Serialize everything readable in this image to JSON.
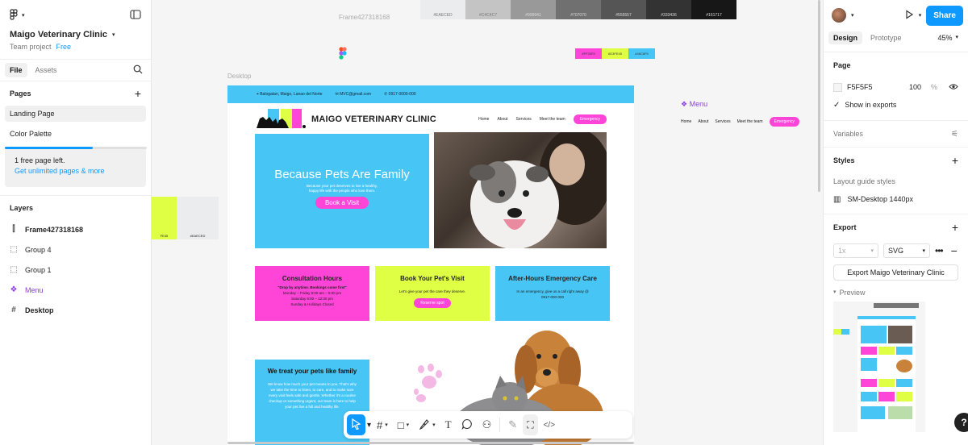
{
  "app": {
    "project_name": "Maigo Veterinary Clinic",
    "team": "Team project",
    "plan": "Free"
  },
  "left_panel": {
    "tabs": [
      "File",
      "Assets"
    ],
    "pages_title": "Pages",
    "pages": [
      "Landing Page",
      "Color Palette"
    ],
    "upsell": {
      "line1": "1 free page left.",
      "line2": "Get unlimited pages & more",
      "progress": 0.62
    },
    "layers_title": "Layers",
    "layers": [
      {
        "name": "Frame427318168",
        "icon": "frame-icon"
      },
      {
        "name": "Group 4",
        "icon": "group-icon"
      },
      {
        "name": "Group 1",
        "icon": "group-icon"
      },
      {
        "name": "Menu",
        "icon": "component-icon"
      },
      {
        "name": "Desktop",
        "icon": "frame-hash-icon"
      }
    ]
  },
  "right_panel": {
    "share": "Share",
    "tabs": [
      "Design",
      "Prototype"
    ],
    "zoom": "45%",
    "page_section": "Page",
    "page_color": "F5F5F5",
    "page_opacity": "100",
    "page_opacity_unit": "%",
    "show_in_exports": "Show in exports",
    "variables": "Variables",
    "styles": "Styles",
    "layout_guide_styles": "Layout guide styles",
    "style_item": "SM-Desktop 1440px",
    "export": "Export",
    "export_scale": "1x",
    "export_format": "SVG",
    "export_button": "Export Maigo Veterinary Clinic",
    "preview": "Preview",
    "help": "?"
  },
  "canvas": {
    "frame_label": "Frame427318168",
    "desktop_label": "Desktop",
    "palette": [
      {
        "hex": "#EAECED",
        "label": "#EAECED"
      },
      {
        "hex": "#C4C4C4",
        "label": "#C4C4C7"
      },
      {
        "hex": "#999999",
        "label": "#999941"
      },
      {
        "hex": "#707070",
        "label": "#707070"
      },
      {
        "hex": "#555555",
        "label": "#555557"
      },
      {
        "hex": "#333333",
        "label": "#333436"
      },
      {
        "hex": "#171717",
        "label": "#161717"
      }
    ],
    "mini_palette": [
      {
        "hex": "#FF44D8",
        "label": "#FF33F5"
      },
      {
        "hex": "#DFFF45",
        "label": "#D3FE45"
      },
      {
        "hex": "#47C6F5",
        "label": "#46C6F5"
      }
    ],
    "side_swatches": [
      {
        "hex": "#DFFF45",
        "label": "FE45"
      },
      {
        "hex": "#EAECED",
        "label": "#EAECED"
      }
    ],
    "menu_label": "Menu"
  },
  "site": {
    "address": "Balogatan, Maigo, Lanao del Norte",
    "email": "MVC@gmail.com",
    "phone": "0917-0000-000",
    "logo_letters": "MVC",
    "brand": "MAIGO VETERINARY CLINIC",
    "nav": [
      "Home",
      "About",
      "Services",
      "Meet the team"
    ],
    "nav_cta": "Emergency",
    "hero_title": "Because Pets Are Family",
    "hero_sub": "Because your pet deserves to live a healthy, happy life with the people who love them.",
    "hero_btn": "Book a Visit",
    "cards": [
      {
        "title": "Consultation Hours",
        "lines": [
          "\"Drop by anytime. Bookings come first\"",
          "Monday – Friday 9:00 am – 5:00 pm",
          "Saturday 9:00 – 12:30 pm",
          "Sunday & Holidays Closed"
        ],
        "color": "#FF44D8"
      },
      {
        "title": "Book Your Pet's Visit",
        "lines": [
          "Let's give your pet the care they deserve."
        ],
        "button": "Reserve spot",
        "color": "#DFFF45"
      },
      {
        "title": "After-Hours Emergency Care",
        "lines": [
          "In an emergency, give us a call right away @",
          "0917-000-000"
        ],
        "color": "#47C6F5"
      }
    ],
    "care_title": "We  treat your pets like family",
    "care_text": "We know how much your pet means to you. That's why we take the time to listen, to care, and to make sure every visit feels safe and gentle. Whether it's a routine checkup or something urgent, our team is here to help your pet live a full and healthy life."
  },
  "colors": {
    "accent": "#0d99ff",
    "pink": "#FF44D8",
    "lime": "#DFFF45",
    "sky": "#47C6F5",
    "purple": "#8b3ddc"
  }
}
